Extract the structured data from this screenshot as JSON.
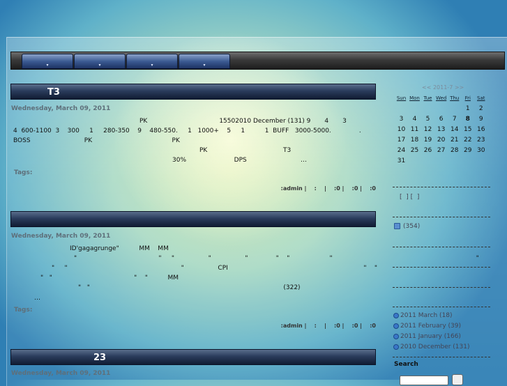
{
  "nav": {
    "tabs": [
      "",
      "",
      "",
      ""
    ],
    "arrow": "▾"
  },
  "posts": [
    {
      "title": "T3",
      "date": "Wednesday, March 09, 2011",
      "lines": [
        "PK                                    15502010 December (131) 9       4       3",
        "4  600-1100  3    300     1     280-350    9    480-550.     1   1000+    5     1          1  BUFF   3000-5000.              .",
        "BOSS                           PK                                        PK",
        "PK                                      T3",
        "30%                        DPS                           …"
      ],
      "tags": "Tags:",
      "meta": ":admin |    :    |    :0 |    :0 |    :0"
    },
    {
      "title": "",
      "date": "Wednesday, March 09, 2011",
      "lines": [
        "ID'gagagrunge\"          MM    MM",
        "\"                                         \"     \"                 \"                 \"              \"    \"                    \"                                                                        \"",
        "\"     \"                                                         \"                 CPI                                                                    \"    \"",
        "\"   \"                                         \"    \"          MM",
        "\"   \"                                                                                                 (322)",
        "…"
      ],
      "tags": "Tags:",
      "meta": ":admin |    :    |    :0 |    :0 |    :0"
    },
    {
      "title": "23",
      "date": "Wednesday, March 09, 2011"
    }
  ],
  "calendar": {
    "header": "<< 2011-7 >>",
    "weekdays": [
      "Sun",
      "Mon",
      "Tue",
      "Wed",
      "Thu",
      "Fri",
      "Sat"
    ],
    "weeks": [
      [
        "",
        "",
        "",
        "",
        "",
        "1",
        "2"
      ],
      [
        "3",
        "4",
        "5",
        "6",
        "7",
        "8",
        "9"
      ],
      [
        "10",
        "11",
        "12",
        "13",
        "14",
        "15",
        "16"
      ],
      [
        "17",
        "18",
        "19",
        "20",
        "21",
        "22",
        "23"
      ],
      [
        "24",
        "25",
        "26",
        "27",
        "28",
        "29",
        "30"
      ],
      [
        "31",
        "",
        "",
        "",
        "",
        "",
        ""
      ]
    ],
    "today": "8"
  },
  "sidebar": {
    "links_text": "[  ] [  ]",
    "rss_count": "(354)",
    "archives": [
      "2011 March (18)",
      "2011 February (39)",
      "2011 January (166)",
      "2010 December (131)"
    ],
    "search_label": "Search"
  }
}
